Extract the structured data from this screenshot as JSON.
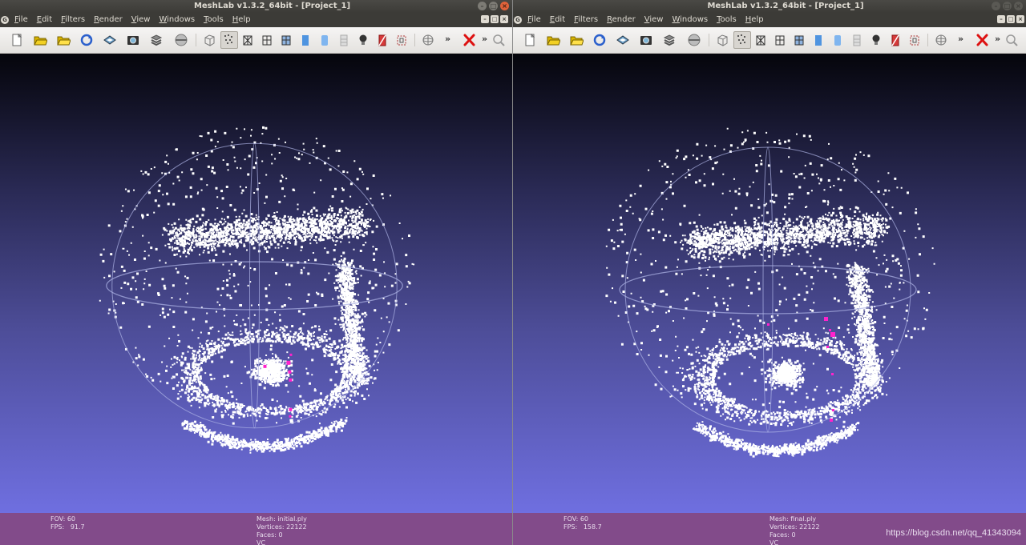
{
  "windows": [
    {
      "id": "left",
      "title": "MeshLab v1.3.2_64bit - [Project_1]",
      "menus": [
        "File",
        "Edit",
        "Filters",
        "Render",
        "View",
        "Windows",
        "Tools",
        "Help"
      ],
      "status": {
        "fov_label": "FOV: 60",
        "fps_label": "FPS:   91.7",
        "mesh_label": "Mesh: initial.ply",
        "vertices_label": "Vertices: 22122",
        "faces_label": "Faces: 0",
        "vc_label": "VC"
      }
    },
    {
      "id": "right",
      "title": "MeshLab v1.3.2_64bit - [Project_1]",
      "menus": [
        "File",
        "Edit",
        "Filters",
        "Render",
        "View",
        "Windows",
        "Tools",
        "Help"
      ],
      "status": {
        "fov_label": "FOV: 60",
        "fps_label": "FPS:   158.7",
        "mesh_label": "Mesh: final.ply",
        "vertices_label": "Vertices: 22122",
        "faces_label": "Faces: 0",
        "vc_label": "VC"
      },
      "watermark": "https://blog.csdn.net/qq_41343094"
    }
  ],
  "toolbar_icons": [
    "new-project-icon",
    "open-project-icon",
    "open-mesh-icon",
    "reload-icon",
    "save-mesh-icon",
    "snapshot-icon",
    "layers-icon",
    "show-hide-icon",
    "bbox-icon",
    "points-icon",
    "wireframe-icon",
    "hiddenlines-icon",
    "flatlines-icon",
    "flat-icon",
    "smooth-icon",
    "texture-icon",
    "light-icon",
    "color-icon",
    "select-faces-icon",
    "trackball-icon",
    "more-icon",
    "delete-icon",
    "more2-icon",
    "zoom-icon"
  ],
  "colors": {
    "point_color": "#ffffff",
    "highlight_color": "#ff22cc",
    "trackball_color": "#aeb4e6",
    "statusbar_bg": "#824b8a",
    "titlebar_bg": "#3c3b37"
  }
}
